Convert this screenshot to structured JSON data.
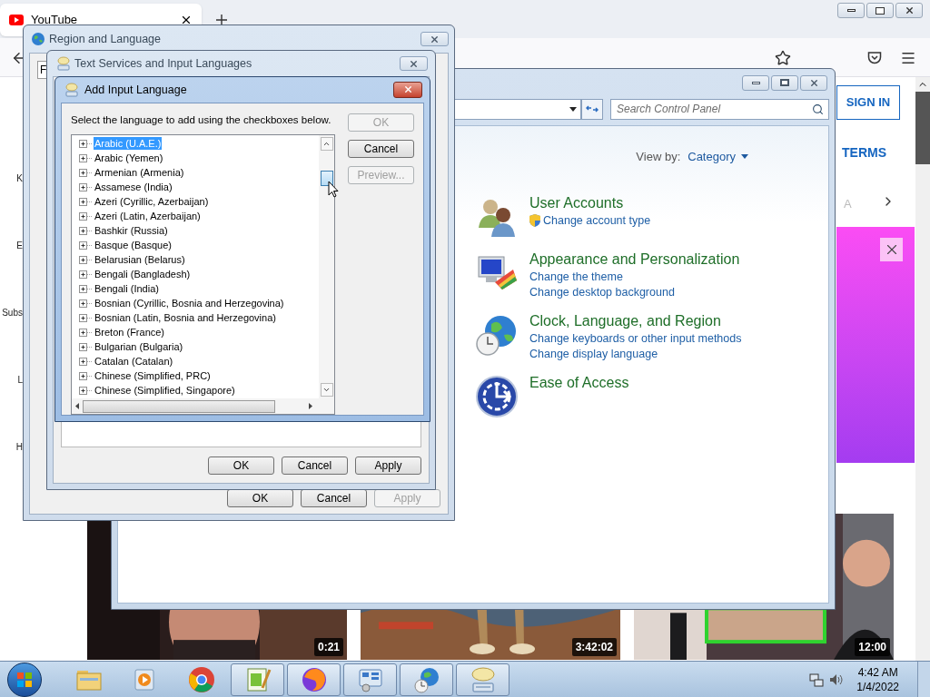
{
  "browser": {
    "tab": {
      "title": "YouTube"
    },
    "page": {
      "edge_fragments": [
        "K",
        "E",
        "Subs",
        "L",
        "H"
      ],
      "sign_in": "SIGN IN",
      "terms": "TERMS",
      "chip_fragment": "A",
      "videos": [
        {
          "duration": "0:21"
        },
        {
          "duration": "3:42:02"
        },
        {
          "duration": "12:00"
        }
      ]
    }
  },
  "control_panel": {
    "search": {
      "placeholder": "Search Control Panel"
    },
    "view_by": {
      "label": "View by:",
      "value": "Category"
    },
    "categories": [
      {
        "title": "User Accounts",
        "links": [
          {
            "text": "Change account type",
            "kind": "admin"
          }
        ]
      },
      {
        "title": "Appearance and Personalization",
        "links": [
          {
            "text": "Change the theme",
            "kind": "plain"
          },
          {
            "text": "Change desktop background",
            "kind": "plain"
          }
        ]
      },
      {
        "title": "Clock, Language, and Region",
        "links": [
          {
            "text": "Change keyboards or other input methods",
            "kind": "plain"
          },
          {
            "text": "Change display language",
            "kind": "plain"
          }
        ]
      },
      {
        "title": "Ease of Access"
      }
    ]
  },
  "region_dialog": {
    "title": "Region and Language",
    "tab_fragment": "F",
    "buttons": [
      {
        "label": "OK",
        "disabled": false
      },
      {
        "label": "Cancel",
        "disabled": false
      },
      {
        "label": "Apply",
        "disabled": true
      }
    ]
  },
  "text_services_dialog": {
    "title": "Text Services and Input Languages",
    "buttons": [
      {
        "label": "OK",
        "disabled": false
      },
      {
        "label": "Cancel",
        "disabled": false
      },
      {
        "label": "Apply",
        "disabled": false
      }
    ]
  },
  "add_language_dialog": {
    "title": "Add Input Language",
    "instruction": "Select the language to add using the checkboxes below.",
    "languages": [
      {
        "name": "Arabic (U.A.E.)",
        "selected": true
      },
      {
        "name": "Arabic (Yemen)",
        "selected": false
      },
      {
        "name": "Armenian (Armenia)",
        "selected": false
      },
      {
        "name": "Assamese (India)",
        "selected": false
      },
      {
        "name": "Azeri (Cyrillic, Azerbaijan)",
        "selected": false
      },
      {
        "name": "Azeri (Latin, Azerbaijan)",
        "selected": false
      },
      {
        "name": "Bashkir (Russia)",
        "selected": false
      },
      {
        "name": "Basque (Basque)",
        "selected": false
      },
      {
        "name": "Belarusian (Belarus)",
        "selected": false
      },
      {
        "name": "Bengali (Bangladesh)",
        "selected": false
      },
      {
        "name": "Bengali (India)",
        "selected": false
      },
      {
        "name": "Bosnian (Cyrillic, Bosnia and Herzegovina)",
        "selected": false
      },
      {
        "name": "Bosnian (Latin, Bosnia and Herzegovina)",
        "selected": false
      },
      {
        "name": "Breton (France)",
        "selected": false
      },
      {
        "name": "Bulgarian (Bulgaria)",
        "selected": false
      },
      {
        "name": "Catalan (Catalan)",
        "selected": false
      },
      {
        "name": "Chinese (Simplified, PRC)",
        "selected": false
      },
      {
        "name": "Chinese (Simplified, Singapore)",
        "selected": false
      }
    ],
    "buttons": [
      {
        "label": "OK",
        "disabled": true
      },
      {
        "label": "Cancel",
        "disabled": false
      },
      {
        "label": "Preview...",
        "disabled": true
      }
    ]
  },
  "taskbar": {
    "apps": [
      {
        "running": false
      },
      {
        "running": false
      },
      {
        "running": false
      },
      {
        "running": true
      },
      {
        "running": true
      },
      {
        "running": true
      },
      {
        "running": true
      },
      {
        "running": true
      }
    ],
    "clock": {
      "time": "4:42 AM",
      "date": "1/4/2022"
    }
  }
}
